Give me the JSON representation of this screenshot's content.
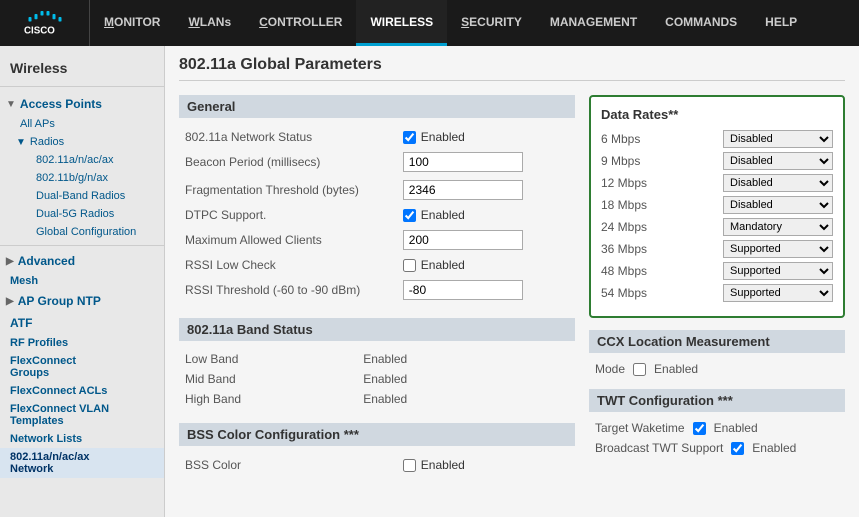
{
  "nav": {
    "items": [
      {
        "label": "MONITOR",
        "id": "monitor",
        "active": false
      },
      {
        "label": "WLANs",
        "id": "wlans",
        "active": false
      },
      {
        "label": "CONTROLLER",
        "id": "controller",
        "active": false
      },
      {
        "label": "WIRELESS",
        "id": "wireless",
        "active": true
      },
      {
        "label": "SECURITY",
        "id": "security",
        "active": false
      },
      {
        "label": "MANAGEMENT",
        "id": "management",
        "active": false
      },
      {
        "label": "COMMANDS",
        "id": "commands",
        "active": false
      },
      {
        "label": "HELP",
        "id": "help",
        "active": false
      }
    ]
  },
  "sidebar": {
    "title": "Wireless",
    "sections": [
      {
        "label": "Access Points",
        "expanded": true,
        "items": [
          {
            "label": "All APs",
            "indent": 1
          },
          {
            "label": "Radios",
            "indent": 1,
            "expanded": true,
            "items": [
              {
                "label": "802.11a/n/ac/ax",
                "indent": 2
              },
              {
                "label": "802.11b/g/n/ax",
                "indent": 2
              },
              {
                "label": "Dual-Band Radios",
                "indent": 2
              },
              {
                "label": "Dual-5G Radios",
                "indent": 2
              },
              {
                "label": "Global Configuration",
                "indent": 2
              }
            ]
          }
        ]
      },
      {
        "label": "Advanced",
        "expanded": false
      },
      {
        "label": "Mesh",
        "standalone": true
      },
      {
        "label": "AP Group NTP",
        "expanded": false
      },
      {
        "label": "ATF",
        "standalone": true
      },
      {
        "label": "RF Profiles",
        "standalone": true
      },
      {
        "label": "FlexConnect Groups",
        "standalone": true
      },
      {
        "label": "FlexConnect ACLs",
        "standalone": true
      },
      {
        "label": "FlexConnect VLAN Templates",
        "standalone": true
      },
      {
        "label": "Network Lists",
        "standalone": true
      },
      {
        "label": "802.11a/n/ac/ax Network",
        "standalone": true,
        "active": true
      }
    ]
  },
  "page": {
    "title": "802.11a Global Parameters",
    "general": {
      "sectionTitle": "General",
      "fields": [
        {
          "label": "802.11a Network Status",
          "type": "checkbox",
          "checked": true,
          "checkLabel": "Enabled"
        },
        {
          "label": "Beacon Period (millisecs)",
          "type": "input",
          "value": "100"
        },
        {
          "label": "Fragmentation Threshold (bytes)",
          "type": "input",
          "value": "2346"
        },
        {
          "label": "DTPC Support.",
          "type": "checkbox",
          "checked": true,
          "checkLabel": "Enabled"
        },
        {
          "label": "Maximum Allowed Clients",
          "type": "input",
          "value": "200"
        },
        {
          "label": "RSSI Low Check",
          "type": "checkbox",
          "checked": false,
          "checkLabel": "Enabled"
        },
        {
          "label": "RSSI Threshold (-60 to -90 dBm)",
          "type": "input",
          "value": "-80"
        }
      ]
    },
    "bandStatus": {
      "sectionTitle": "802.11a Band Status",
      "rows": [
        {
          "label": "Low Band",
          "value": "Enabled"
        },
        {
          "label": "Mid Band",
          "value": "Enabled"
        },
        {
          "label": "High Band",
          "value": "Enabled"
        }
      ]
    },
    "bssColor": {
      "sectionTitle": "BSS Color Configuration ***",
      "fields": [
        {
          "label": "BSS Color",
          "type": "checkbox",
          "checked": false,
          "checkLabel": "Enabled"
        }
      ]
    },
    "dataRates": {
      "sectionTitle": "Data Rates**",
      "rates": [
        {
          "label": "6 Mbps",
          "value": "Disabled",
          "options": [
            "Disabled",
            "Mandatory",
            "Supported"
          ]
        },
        {
          "label": "9 Mbps",
          "value": "Disabled",
          "options": [
            "Disabled",
            "Mandatory",
            "Supported"
          ]
        },
        {
          "label": "12 Mbps",
          "value": "Disabled",
          "options": [
            "Disabled",
            "Mandatory",
            "Supported"
          ]
        },
        {
          "label": "18 Mbps",
          "value": "Disabled",
          "options": [
            "Disabled",
            "Mandatory",
            "Supported"
          ]
        },
        {
          "label": "24 Mbps",
          "value": "Mandatory",
          "options": [
            "Disabled",
            "Mandatory",
            "Supported"
          ]
        },
        {
          "label": "36 Mbps",
          "value": "Supported",
          "options": [
            "Disabled",
            "Mandatory",
            "Supported"
          ]
        },
        {
          "label": "48 Mbps",
          "value": "Supported",
          "options": [
            "Disabled",
            "Mandatory",
            "Supported"
          ]
        },
        {
          "label": "54 Mbps",
          "value": "Supported",
          "options": [
            "Disabled",
            "Mandatory",
            "Supported"
          ]
        }
      ]
    },
    "ccx": {
      "sectionTitle": "CCX Location Measurement",
      "rows": [
        {
          "label": "Mode",
          "type": "checkbox",
          "checked": false,
          "checkLabel": "Enabled"
        }
      ]
    },
    "twt": {
      "sectionTitle": "TWT Configuration ***",
      "rows": [
        {
          "label": "Target Waketime",
          "type": "checkbox",
          "checked": true,
          "checkLabel": "Enabled"
        },
        {
          "label": "Broadcast TWT Support",
          "type": "checkbox",
          "checked": true,
          "checkLabel": "Enabled"
        }
      ]
    }
  }
}
